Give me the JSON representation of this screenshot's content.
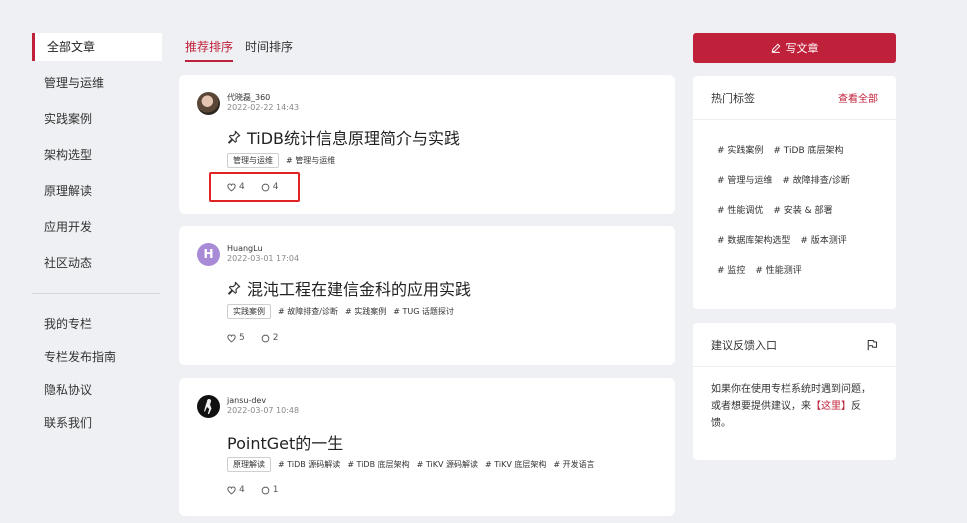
{
  "sidebar": {
    "primary": [
      "全部文章",
      "管理与运维",
      "实践案例",
      "架构选型",
      "原理解读",
      "应用开发",
      "社区动态"
    ],
    "secondary": [
      "我的专栏",
      "专栏发布指南",
      "隐私协议",
      "联系我们"
    ]
  },
  "sort_tabs": [
    "推荐排序",
    "时间排序"
  ],
  "articles": [
    {
      "author": "代晓磊_360",
      "date": "2022-02-22 14:43",
      "title": "TiDB统计信息原理简介与实践",
      "category": "管理与运维",
      "tags": [
        "# 管理与运维"
      ],
      "likes": "4",
      "comments": "4",
      "avatar_letter": ""
    },
    {
      "author": "HuangLu",
      "date": "2022-03-01 17:04",
      "title": "混沌工程在建信金科的应用实践",
      "category": "实践案例",
      "tags": [
        "# 故障排查/诊断",
        "# 实践案例",
        "# TUG 话题探讨"
      ],
      "likes": "5",
      "comments": "2",
      "avatar_letter": "H"
    },
    {
      "author": "jansu-dev",
      "date": "2022-03-07 10:48",
      "title": "PointGet的一生",
      "category": "原理解读",
      "tags": [
        "# TiDB 源码解读",
        "# TiDB 底层架构",
        "# TiKV 源码解读",
        "# TiKV 底层架构",
        "# 开发语言"
      ],
      "likes": "4",
      "comments": "1",
      "avatar_letter": ""
    }
  ],
  "write_button": "写文章",
  "hot_tags": {
    "title": "热门标签",
    "see_all": "查看全部",
    "rows": [
      [
        "# 实践案例",
        "# TiDB 底层架构"
      ],
      [
        "# 管理与运维",
        "# 故障排查/诊断"
      ],
      [
        "# 性能调优",
        "# 安装 & 部署"
      ],
      [
        "# 数据库架构选型",
        "# 版本测评"
      ],
      [
        "# 监控",
        "# 性能测评"
      ]
    ]
  },
  "feedback": {
    "title": "建议反馈入口",
    "text_before": "如果你在使用专栏系统时遇到问题，或者想要提供建议，来",
    "link": "【这里】",
    "text_after": "反馈。"
  },
  "colors": {
    "accent": "#c0213a",
    "highlight": "#e02424"
  }
}
